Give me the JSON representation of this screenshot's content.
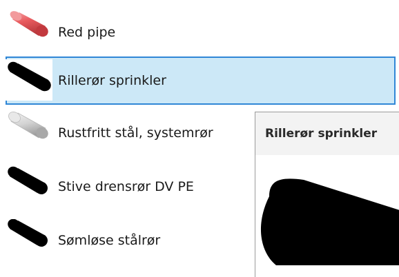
{
  "items": [
    {
      "label": "Red pipe",
      "icon": "red-pipe-icon",
      "color": "#e85a5e",
      "selected": false
    },
    {
      "label": "Rillerør sprinkler",
      "icon": "black-pipe-icon",
      "color": "#000000",
      "selected": true
    },
    {
      "label": "Rustfritt stål, systemrør",
      "icon": "steel-pipe-icon",
      "color": "#d9d9d9",
      "selected": false
    },
    {
      "label": "Stive drensrør DV PE",
      "icon": "black-pipe-icon",
      "color": "#000000",
      "selected": false
    },
    {
      "label": "Sømløse stålrør",
      "icon": "black-pipe-icon",
      "color": "#000000",
      "selected": false
    }
  ],
  "preview": {
    "title": "Rillerør sprinkler",
    "icon": "black-pipe-preview-image",
    "color": "#000000"
  },
  "colors": {
    "selection_background": "#cce8f7",
    "selection_border": "#2f86d6"
  }
}
